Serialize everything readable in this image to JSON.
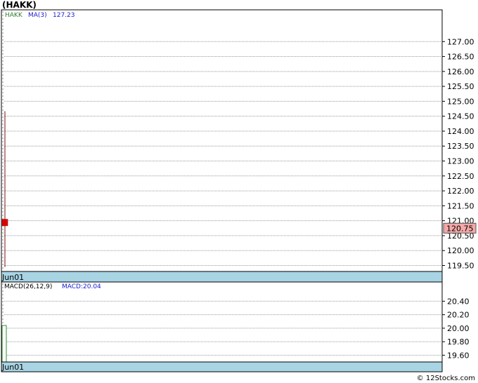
{
  "title": "(HAKK)",
  "credit": "© 12Stocks.com",
  "chart_data": [
    {
      "type": "candlestick",
      "legend": [
        {
          "text": "HAKK",
          "color": "#2e7d32"
        },
        {
          "text": "MA(3)",
          "color": "#1a1acc"
        },
        {
          "text": "127.23",
          "color": "#1a1acc"
        }
      ],
      "ylim": [
        119.3,
        127.5
      ],
      "yticks": [
        "127.00",
        "126.50",
        "126.00",
        "125.50",
        "125.00",
        "124.50",
        "124.00",
        "123.50",
        "123.00",
        "122.50",
        "122.00",
        "121.50",
        "121.00",
        "120.50",
        "120.00",
        "119.50"
      ],
      "xlabels": [
        "Jun01"
      ],
      "candles": [
        {
          "date": "Jun01",
          "open": 121.05,
          "close": 120.83,
          "high": 124.67,
          "low": 119.45
        }
      ],
      "last_price": "120.75",
      "colors": {
        "down": "#dd0000",
        "wick": "#7a1010",
        "price_tag": "#f4a8a8",
        "date_band": "#a8d4e4"
      },
      "grid": true
    },
    {
      "type": "bar",
      "legend": [
        {
          "text": "MACD(26,12,9)",
          "color": "#000000"
        },
        {
          "text": "MACD:20.04",
          "color": "#1a1acc"
        }
      ],
      "ylim": [
        19.5,
        20.56
      ],
      "yticks": [
        "20.40",
        "20.20",
        "20.00",
        "19.80",
        "19.60"
      ],
      "xlabels": [
        "Jun01"
      ],
      "values": [
        20.04
      ],
      "colors": {
        "bar": "#2e8b2e",
        "date_band": "#a8d4e4"
      },
      "grid": true
    }
  ]
}
